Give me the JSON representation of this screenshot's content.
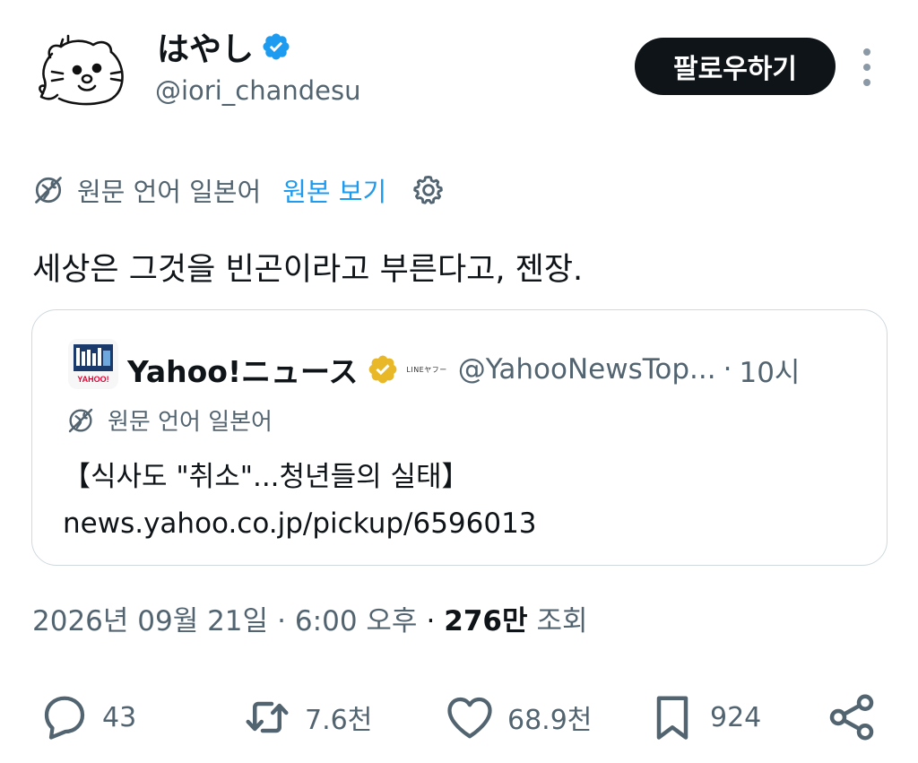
{
  "header": {
    "display_name": "はやし",
    "handle": "@iori_chandesu",
    "follow_label": "팔로우하기"
  },
  "translation": {
    "source_language": "원문 언어 일본어",
    "show_original": "원본 보기"
  },
  "tweet": {
    "text": "세상은 그것을 빈곤이라고 부른다고, 젠장."
  },
  "quote": {
    "name": "Yahoo!ニュース",
    "affiliation": "LINEヤフー",
    "handle": "@YahooNewsTop...",
    "separator": "·",
    "time": "10시",
    "source_language": "원문 언어 일본어",
    "body_line1": "【식사도 \"취소\"...청년들의 실태】",
    "body_link": "news.yahoo.co.jp/pickup/6596013",
    "avatar_label": "YAHOO!"
  },
  "meta": {
    "date": "2026년 09월 21일",
    "dot1": "·",
    "time": "6:00 오후",
    "dot2": "·",
    "views_count": "276만",
    "views_label": "조회"
  },
  "actions": {
    "replies": "43",
    "reposts": "7.6천",
    "likes": "68.9천",
    "bookmarks": "924"
  },
  "colors": {
    "accent": "#1d9bf0",
    "text_primary": "#0f1419",
    "text_secondary": "#536471",
    "border": "#cfd9de",
    "verified_gold": "#e8b829"
  },
  "icons": {
    "verified": "blue-check-icon",
    "quote_verified": "gold-check-icon",
    "translate": "globe-off-icon",
    "settings": "gear-icon",
    "reply": "comment-icon",
    "repost": "repost-icon",
    "like": "heart-icon",
    "bookmark": "bookmark-icon",
    "share": "share-icon",
    "more": "more-vertical-icon"
  }
}
